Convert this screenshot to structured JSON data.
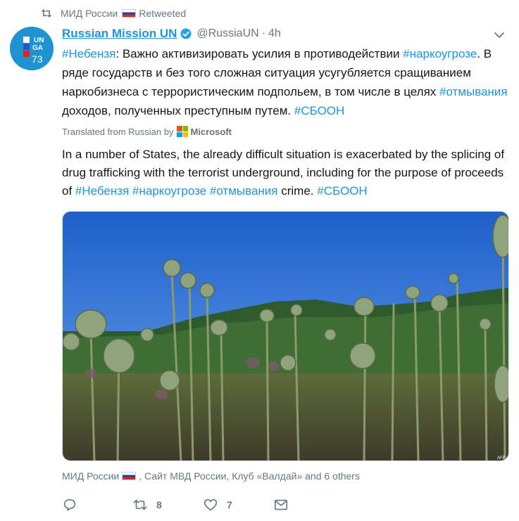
{
  "retweet_header": {
    "icon": "retweet-icon",
    "account": "МИД России",
    "flag": "flag-russia",
    "label": "Retweeted"
  },
  "tweet": {
    "avatar_icon": "unga-73-avatar",
    "avatar_text": [
      "UN",
      "GA",
      "73"
    ],
    "display_name": "Russian Mission UN",
    "verified_icon": "verified-badge-icon",
    "handle": "@RussiaUN",
    "separator": "·",
    "time": "4h",
    "menu_icon": "chevron-down-icon",
    "text": {
      "tag1": "#Небензя",
      "part1": ": Важно активизировать усилия в противодействии ",
      "tag2": "#наркоугрозе",
      "part2": ". В ряде государств и без того сложная ситуация усугубляется сращиванием наркобизнеса с террористическим подпольем, в том числе в целях ",
      "tag3": "#отмывания",
      "part3": " доходов, полученных преступным путем. ",
      "tag4": "#СБООН"
    },
    "translation": {
      "label": "Translated from Russian by",
      "provider": "Microsoft",
      "part1": "In a number of States, the already difficult situation is exacerbated by the splicing of drug trafficking with the terrorist underground, including for the purpose of proceeds of ",
      "tag1": "#Небензя",
      "tag2": "#наркоугрозе",
      "tag3": "#отмывания",
      "part2": " crime. ",
      "tag4": "#СБООН"
    },
    "media": {
      "type": "photo",
      "watermark": "AFP"
    },
    "related": {
      "first": "МИД России",
      "rest": ", Сайт МВД России, Клуб «Валдай» and 6 others"
    },
    "actions": {
      "reply_icon": "reply-icon",
      "retweet_icon": "retweet-icon",
      "retweet_count": "8",
      "like_icon": "heart-icon",
      "like_count": "7",
      "dm_icon": "envelope-icon"
    }
  },
  "colors": {
    "accent": "#1b95e0",
    "secondary_text": "#657786",
    "text": "#14171a"
  }
}
